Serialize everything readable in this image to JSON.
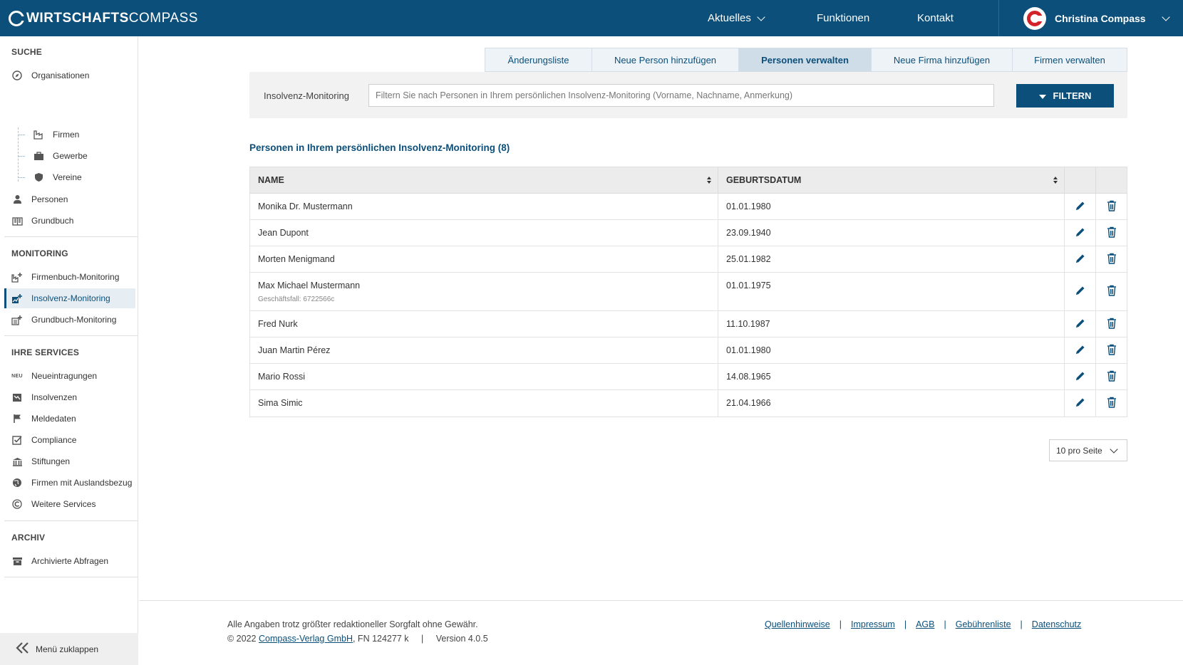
{
  "brand": {
    "name_bold": "WIRTSCHAFTS",
    "name_light": "COMPASS"
  },
  "topnav": [
    {
      "label": "Aktuelles",
      "has_dropdown": true
    },
    {
      "label": "Funktionen"
    },
    {
      "label": "Kontakt"
    }
  ],
  "user": {
    "name": "Christina Compass"
  },
  "sidebar": {
    "sections": [
      {
        "title": "SUCHE",
        "items": [
          {
            "label": "Organisationen",
            "icon": "compass-icon"
          },
          {
            "label": "Firmen",
            "icon": "factory-icon",
            "sub": true
          },
          {
            "label": "Gewerbe",
            "icon": "briefcase-icon",
            "sub": true
          },
          {
            "label": "Vereine",
            "icon": "shield-icon",
            "sub": true
          },
          {
            "label": "Personen",
            "icon": "person-icon"
          },
          {
            "label": "Grundbuch",
            "icon": "book-icon"
          }
        ]
      },
      {
        "title": "MONITORING",
        "items": [
          {
            "label": "Firmenbuch-Monitoring",
            "icon": "monitor-add-icon"
          },
          {
            "label": "Insolvenz-Monitoring",
            "icon": "monitor-add-icon",
            "active": true
          },
          {
            "label": "Grundbuch-Monitoring",
            "icon": "monitor-add-icon"
          }
        ]
      },
      {
        "title": "IHRE SERVICES",
        "items": [
          {
            "label": "Neueintragungen",
            "icon": "neu-icon",
            "icon_text": "NEU"
          },
          {
            "label": "Insolvenzen",
            "icon": "trend-down-icon"
          },
          {
            "label": "Meldedaten",
            "icon": "flag-icon"
          },
          {
            "label": "Compliance",
            "icon": "checkbox-icon"
          },
          {
            "label": "Stiftungen",
            "icon": "columns-icon"
          },
          {
            "label": "Firmen mit Auslandsbezug",
            "icon": "globe-icon"
          },
          {
            "label": "Weitere Services",
            "icon": "c-logo-icon"
          }
        ]
      },
      {
        "title": "ARCHIV",
        "items": [
          {
            "label": "Archivierte Abfragen",
            "icon": "archive-icon"
          }
        ]
      }
    ],
    "collapse_label": "Menü zuklappen"
  },
  "tabs": [
    {
      "label": "Änderungsliste"
    },
    {
      "label": "Neue Person hinzufügen"
    },
    {
      "label": "Personen verwalten",
      "active": true
    },
    {
      "label": "Neue Firma hinzufügen"
    },
    {
      "label": "Firmen verwalten"
    }
  ],
  "filter": {
    "label": "Insolvenz-Monitoring",
    "placeholder": "Filtern Sie nach Personen in Ihrem persönlichen Insolvenz-Monitoring (Vorname, Nachname, Anmerkung)",
    "value": "",
    "button_label": "FILTERN"
  },
  "list": {
    "title": "Personen in Ihrem persönlichen Insolvenz-Monitoring (8)",
    "columns": [
      "NAME",
      "GEBURTSDATUM"
    ],
    "rows": [
      {
        "name": "Monika Dr. Mustermann",
        "date": "01.01.1980"
      },
      {
        "name": "Jean Dupont",
        "date": "23.09.1940"
      },
      {
        "name": "Morten Menigmand",
        "date": "25.01.1982"
      },
      {
        "name": "Max Michael Mustermann",
        "note": "Geschäftsfall: 6722566c",
        "date": "01.01.1975"
      },
      {
        "name": "Fred Nurk",
        "date": "11.10.1987"
      },
      {
        "name": "Juan Martin Pérez",
        "date": "01.01.1980"
      },
      {
        "name": "Mario Rossi",
        "date": "14.08.1965"
      },
      {
        "name": "Sima Simic",
        "date": "21.04.1966"
      }
    ]
  },
  "pagination": {
    "per_page_label": "10 pro Seite"
  },
  "footer": {
    "disclaimer": "Alle Angaben trotz größter redaktioneller Sorgfalt ohne Gewähr.",
    "copyright_prefix": "© 2022",
    "company_link": "Compass-Verlag GmbH",
    "registry": ", FN 124277 k",
    "version": "Version 4.0.5",
    "links": [
      "Quellenhinweise",
      "Impressum",
      "AGB",
      "Gebührenliste",
      "Datenschutz"
    ]
  },
  "colors": {
    "primary": "#0b4f7a",
    "accent_red": "#d2232a",
    "tab_active": "#cfdde8"
  }
}
